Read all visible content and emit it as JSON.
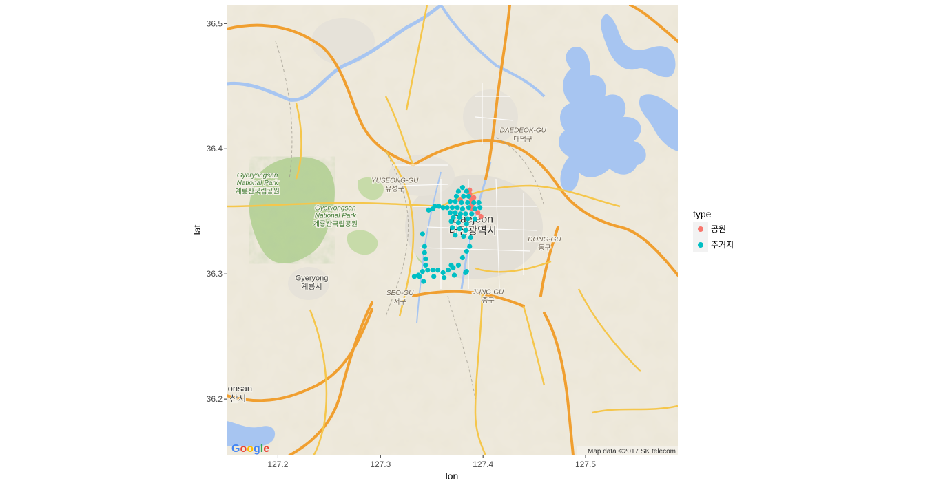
{
  "chart_data": {
    "type": "scatter",
    "title": "",
    "xlabel": "lon",
    "ylabel": "lat",
    "xlim": [
      127.15,
      127.59
    ],
    "ylim": [
      36.155,
      36.515
    ],
    "x_ticks": [
      127.2,
      127.3,
      127.4,
      127.5
    ],
    "y_ticks": [
      36.2,
      36.3,
      36.4,
      36.5
    ],
    "x_tick_labels": [
      "127.2",
      "127.3",
      "127.4",
      "127.5"
    ],
    "y_tick_labels": [
      "36.2",
      "36.3",
      "36.4",
      "36.5"
    ],
    "grid": true,
    "legend": {
      "title": "type",
      "position": "right",
      "entries": [
        {
          "label": "공원",
          "color": "#F8766D"
        },
        {
          "label": "주거지",
          "color": "#00BFC4"
        }
      ]
    },
    "series": [
      {
        "name": "공원",
        "color": "#F8766D",
        "points": [
          [
            127.387,
            36.367
          ],
          [
            127.387,
            36.364
          ],
          [
            127.388,
            36.361
          ],
          [
            127.389,
            36.359
          ],
          [
            127.39,
            36.357
          ],
          [
            127.391,
            36.361
          ],
          [
            127.389,
            36.352
          ],
          [
            127.395,
            36.349
          ],
          [
            127.398,
            36.346
          ],
          [
            127.378,
            36.359
          ],
          [
            127.389,
            36.355
          ]
        ]
      },
      {
        "name": "주거지",
        "color": "#00BFC4",
        "points": [
          [
            127.38,
            36.369
          ],
          [
            127.376,
            36.366
          ],
          [
            127.384,
            36.366
          ],
          [
            127.374,
            36.362
          ],
          [
            127.381,
            36.362
          ],
          [
            127.386,
            36.362
          ],
          [
            127.368,
            36.358
          ],
          [
            127.373,
            36.358
          ],
          [
            127.379,
            36.357
          ],
          [
            127.385,
            36.357
          ],
          [
            127.391,
            36.357
          ],
          [
            127.396,
            36.357
          ],
          [
            127.353,
            36.354
          ],
          [
            127.357,
            36.354
          ],
          [
            127.361,
            36.353
          ],
          [
            127.365,
            36.353
          ],
          [
            127.37,
            36.353
          ],
          [
            127.375,
            36.353
          ],
          [
            127.38,
            36.352
          ],
          [
            127.386,
            36.353
          ],
          [
            127.392,
            36.352
          ],
          [
            127.397,
            36.353
          ],
          [
            127.347,
            36.351
          ],
          [
            127.351,
            36.352
          ],
          [
            127.368,
            36.349
          ],
          [
            127.373,
            36.349
          ],
          [
            127.378,
            36.348
          ],
          [
            127.383,
            36.348
          ],
          [
            127.389,
            36.348
          ],
          [
            127.371,
            36.345
          ],
          [
            127.377,
            36.345
          ],
          [
            127.385,
            36.344
          ],
          [
            127.392,
            36.344
          ],
          [
            127.369,
            36.342
          ],
          [
            127.376,
            36.341
          ],
          [
            127.384,
            36.34
          ],
          [
            127.37,
            36.337
          ],
          [
            127.377,
            36.336
          ],
          [
            127.383,
            36.335
          ],
          [
            127.373,
            36.331
          ],
          [
            127.381,
            36.33
          ],
          [
            127.388,
            36.329
          ],
          [
            127.341,
            36.332
          ],
          [
            127.343,
            36.322
          ],
          [
            127.343,
            36.317
          ],
          [
            127.344,
            36.312
          ],
          [
            127.344,
            36.307
          ],
          [
            127.346,
            36.303
          ],
          [
            127.351,
            36.303
          ],
          [
            127.356,
            36.303
          ],
          [
            127.361,
            36.301
          ],
          [
            127.366,
            36.303
          ],
          [
            127.371,
            36.305
          ],
          [
            127.376,
            36.307
          ],
          [
            127.341,
            36.302
          ],
          [
            127.337,
            36.299
          ],
          [
            127.333,
            36.298
          ],
          [
            127.338,
            36.298
          ],
          [
            127.342,
            36.294
          ],
          [
            127.352,
            36.298
          ],
          [
            127.362,
            36.297
          ],
          [
            127.372,
            36.299
          ],
          [
            127.383,
            36.301
          ],
          [
            127.38,
            36.313
          ],
          [
            127.384,
            36.318
          ],
          [
            127.387,
            36.322
          ],
          [
            127.384,
            36.302
          ],
          [
            127.369,
            36.307
          ]
        ]
      }
    ],
    "map": {
      "attribution": "Map data ©2017 SK telecom",
      "logo": "Google",
      "labels": [
        {
          "text": "Daejeon",
          "lon": 127.39,
          "lat": 36.341,
          "size": 16,
          "color": "#333333",
          "italic": false
        },
        {
          "text": "대전광역시",
          "lon": 127.39,
          "lat": 36.332,
          "size": 15,
          "color": "#333333",
          "italic": false
        },
        {
          "text": "DAEDEOK-GU",
          "lon": 127.439,
          "lat": 36.413,
          "size": 10,
          "color": "#6e6456",
          "italic": true
        },
        {
          "text": "대덕구",
          "lon": 127.439,
          "lat": 36.406,
          "size": 10,
          "color": "#6e6456",
          "italic": false
        },
        {
          "text": "YUSEONG-GU",
          "lon": 127.314,
          "lat": 36.373,
          "size": 10,
          "color": "#6e6456",
          "italic": true
        },
        {
          "text": "유성구",
          "lon": 127.314,
          "lat": 36.366,
          "size": 10,
          "color": "#6e6456",
          "italic": false
        },
        {
          "text": "DONG-GU",
          "lon": 127.46,
          "lat": 36.326,
          "size": 10,
          "color": "#6e6456",
          "italic": true
        },
        {
          "text": "동구",
          "lon": 127.46,
          "lat": 36.319,
          "size": 10,
          "color": "#6e6456",
          "italic": false
        },
        {
          "text": "SEO-GU",
          "lon": 127.319,
          "lat": 36.283,
          "size": 10,
          "color": "#6e6456",
          "italic": true
        },
        {
          "text": "서구",
          "lon": 127.319,
          "lat": 36.276,
          "size": 10,
          "color": "#6e6456",
          "italic": false
        },
        {
          "text": "JUNG-GU",
          "lon": 127.405,
          "lat": 36.284,
          "size": 10,
          "color": "#6e6456",
          "italic": true
        },
        {
          "text": "중구",
          "lon": 127.405,
          "lat": 36.277,
          "size": 10,
          "color": "#6e6456",
          "italic": false
        },
        {
          "text": "Gyeryongsan",
          "lon": 127.18,
          "lat": 36.377,
          "size": 10,
          "color": "#3f7a32",
          "italic": true
        },
        {
          "text": "National Park",
          "lon": 127.18,
          "lat": 36.371,
          "size": 10,
          "color": "#3f7a32",
          "italic": true
        },
        {
          "text": "계룡산국립공원",
          "lon": 127.18,
          "lat": 36.364,
          "size": 10,
          "color": "#3f7a32",
          "italic": false
        },
        {
          "text": "Gyeryongsan",
          "lon": 127.256,
          "lat": 36.351,
          "size": 10,
          "color": "#3f7a32",
          "italic": true
        },
        {
          "text": "National Park",
          "lon": 127.256,
          "lat": 36.345,
          "size": 10,
          "color": "#3f7a32",
          "italic": true
        },
        {
          "text": "계룡산국립공원",
          "lon": 127.256,
          "lat": 36.338,
          "size": 10,
          "color": "#3f7a32",
          "italic": false
        },
        {
          "text": "Gyeryong",
          "lon": 127.233,
          "lat": 36.295,
          "size": 11,
          "color": "#444444",
          "italic": false
        },
        {
          "text": "계룡시",
          "lon": 127.233,
          "lat": 36.288,
          "size": 11,
          "color": "#444444",
          "italic": false
        },
        {
          "text": "onsan",
          "lon": 127.163,
          "lat": 36.206,
          "size": 13,
          "color": "#444444",
          "italic": false
        },
        {
          "text": "산시",
          "lon": 127.161,
          "lat": 36.198,
          "size": 13,
          "color": "#444444",
          "italic": false
        }
      ]
    }
  }
}
